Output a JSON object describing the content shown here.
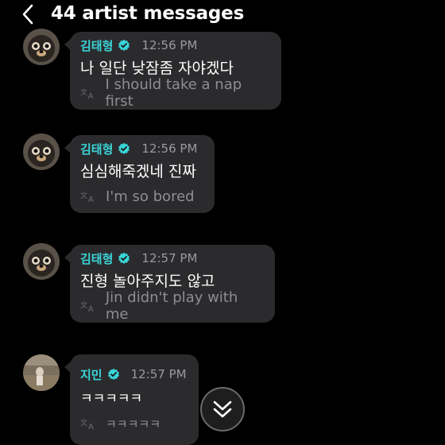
{
  "header": {
    "title": "44 artist messages"
  },
  "messages": [
    {
      "sender": "김태형",
      "time": "12:56 PM",
      "text": "나 일단 낮잠좀 자야겠다",
      "translation": "I should take a nap first"
    },
    {
      "sender": "김태형",
      "time": "12:56 PM",
      "text": "심심해죽겠네 진짜",
      "translation": "I'm so bored"
    },
    {
      "sender": "김태형",
      "time": "12:57 PM",
      "text": "진형 놀아주지도 않고",
      "translation": "Jin didn't play with me"
    },
    {
      "sender": "지민",
      "time": "12:57 PM",
      "text": "ㅋㅋㅋㅋㅋ",
      "translation": "ㅋㅋㅋㅋㅋ"
    }
  ],
  "colors": {
    "background": "#000000",
    "bubble": "#2b2b2d",
    "sender_name": "#3ad6d9",
    "verified_badge": "#3ad6d9",
    "timestamp": "#9a9a9c",
    "translation": "#8e8e90"
  },
  "icons": {
    "back": "chevron-left-icon",
    "verified": "verified-badge-icon",
    "translate": "translate-icon",
    "scroll_down": "double-chevron-down-icon"
  }
}
